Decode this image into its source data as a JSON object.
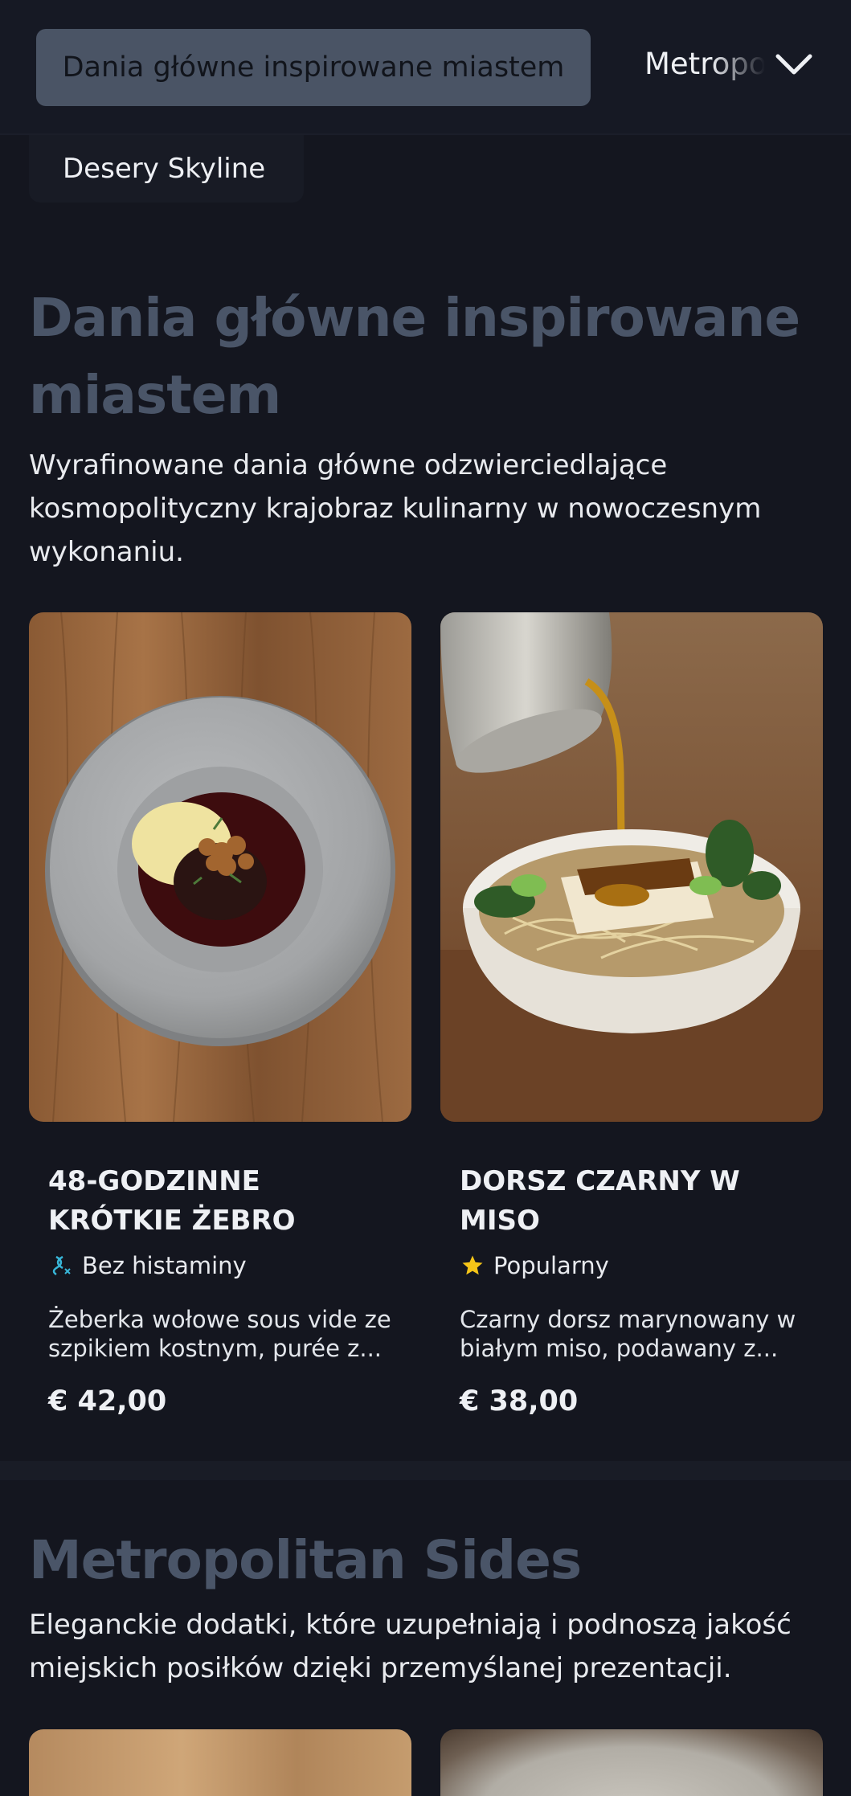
{
  "nav": {
    "active_tab": "Dania główne inspirowane miastem",
    "next_tab": "Metropolitan Sides",
    "prev_tab": "Desery Skyline"
  },
  "section_mains": {
    "title": "Dania główne inspirowane miastem",
    "description": "Wyrafinowane dania główne odzwierciedlające kosmopolityczny krajobraz kulinarny w nowoczesnym wykonaniu.",
    "items": [
      {
        "name": "48-GODZINNE KRÓTKIE ŻEBRO",
        "badge": "Bez histaminy",
        "badge_icon": "dna-icon",
        "description": "Żeberka wołowe sous vide ze szpikiem kostnym, purée z...",
        "price": "€ 42,00"
      },
      {
        "name": "DORSZ CZARNY W MISO",
        "badge": "Popularny",
        "badge_icon": "star-icon",
        "description": "Czarny dorsz marynowany w białym miso, podawany z...",
        "price": "€ 38,00"
      }
    ]
  },
  "section_sides": {
    "title": "Metropolitan Sides",
    "description": "Eleganckie dodatki, które uzupełniają i podnoszą jakość miejskich posiłków dzięki przemyślanej prezentacji."
  },
  "colors": {
    "background": "#14161f",
    "active_tab": "#4a5465",
    "section_title": "#4a5568",
    "star": "#f5c518",
    "dna": "#38b6d8"
  }
}
